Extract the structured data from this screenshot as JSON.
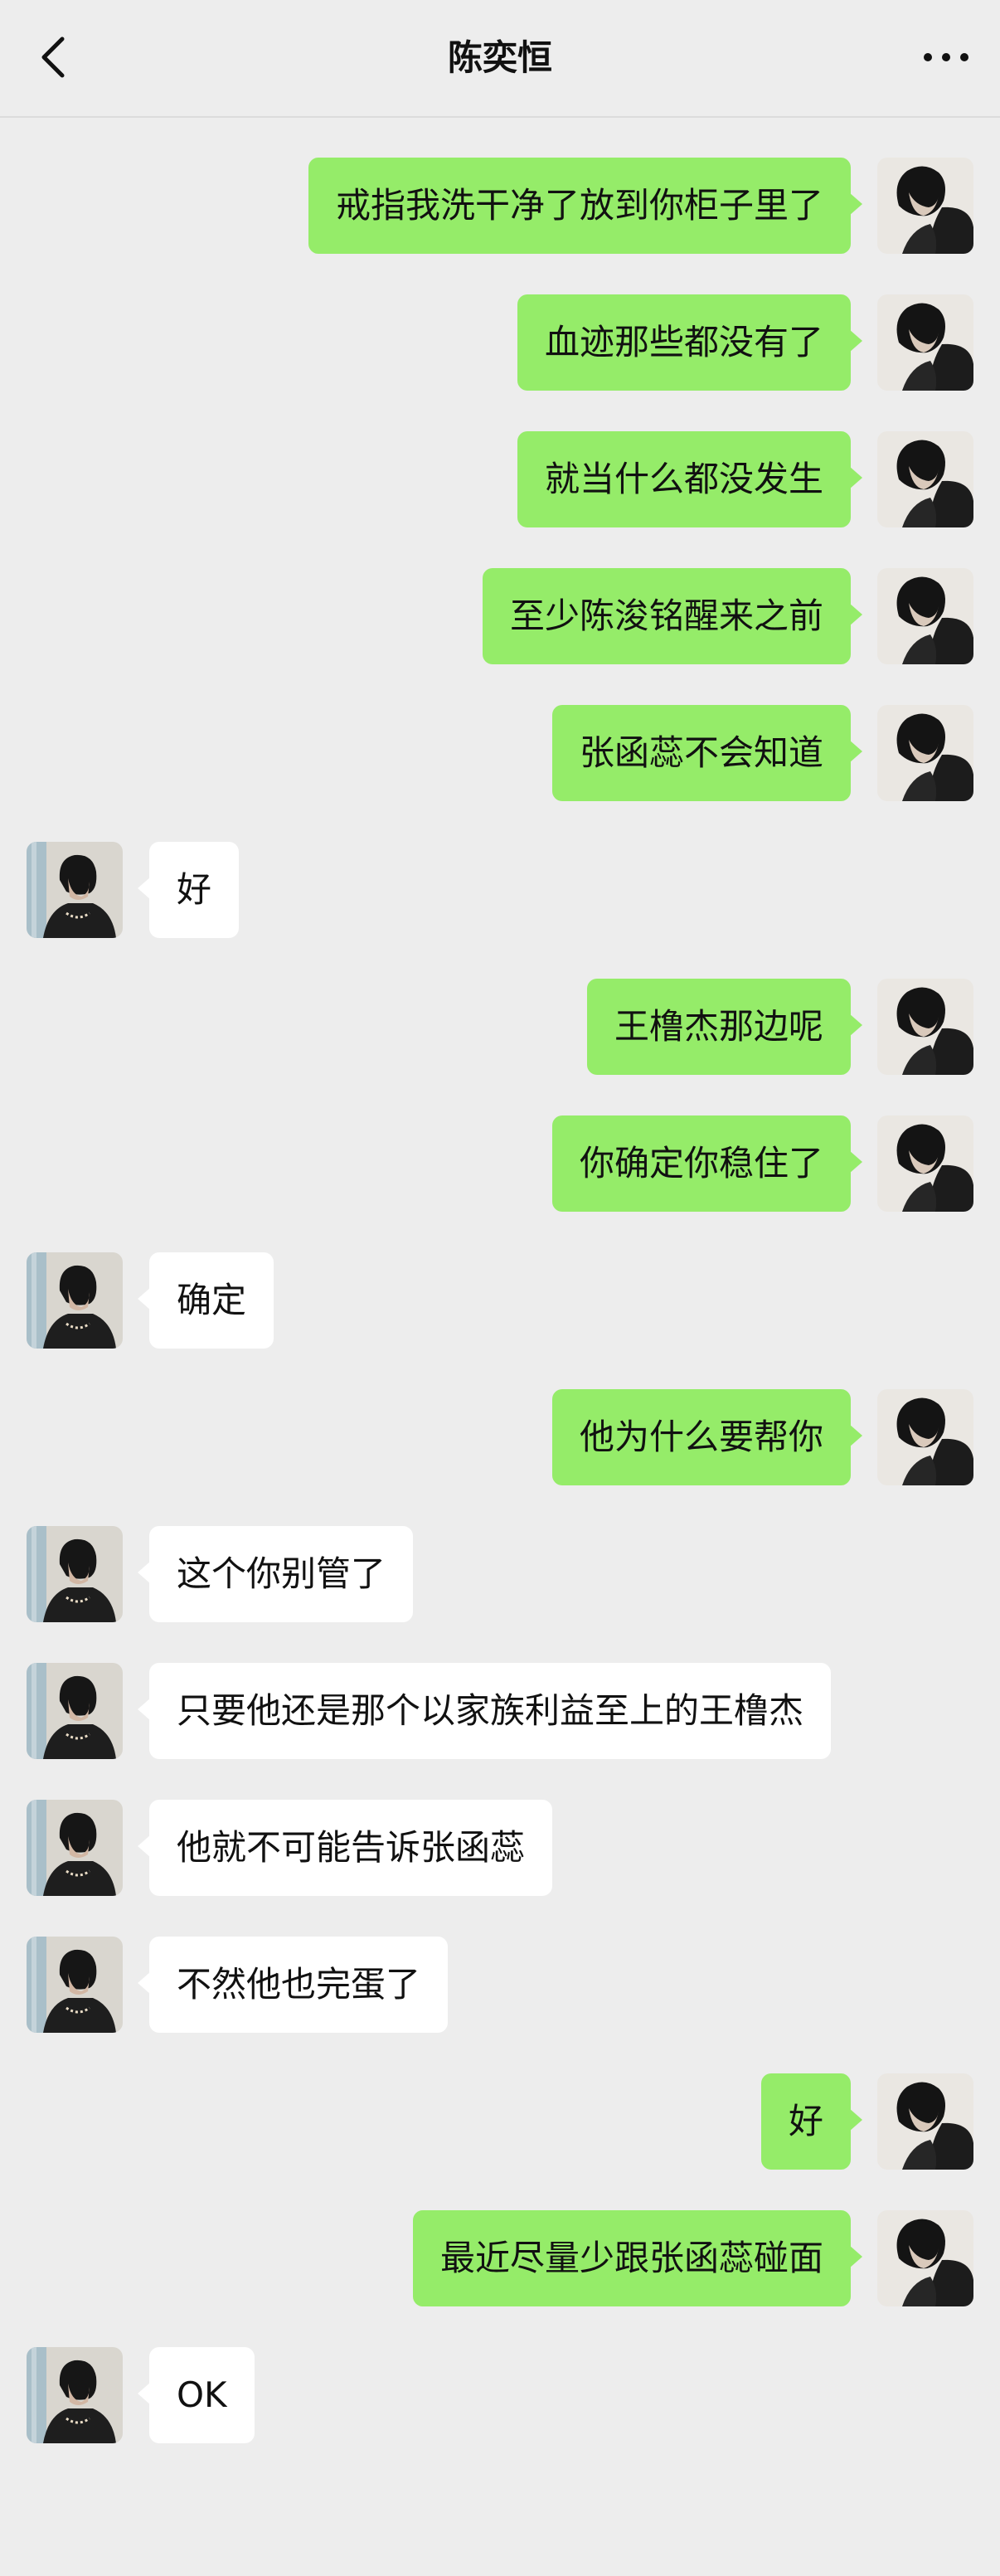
{
  "header": {
    "title": "陈奕恒",
    "back_icon": "chevron-left-icon",
    "more_icon": "ellipsis-icon"
  },
  "colors": {
    "background": "#ededed",
    "outgoing_bubble": "#95ec69",
    "incoming_bubble": "#ffffff"
  },
  "messages": [
    {
      "side": "out",
      "text": "戒指我洗干净了放到你柜子里了"
    },
    {
      "side": "out",
      "text": "血迹那些都没有了"
    },
    {
      "side": "out",
      "text": "就当什么都没发生"
    },
    {
      "side": "out",
      "text": "至少陈浚铭醒来之前"
    },
    {
      "side": "out",
      "text": "张函蕊不会知道"
    },
    {
      "side": "in",
      "text": "好"
    },
    {
      "side": "out",
      "text": "王橹杰那边呢"
    },
    {
      "side": "out",
      "text": "你确定你稳住了"
    },
    {
      "side": "in",
      "text": "确定"
    },
    {
      "side": "out",
      "text": "他为什么要帮你"
    },
    {
      "side": "in",
      "text": "这个你别管了"
    },
    {
      "side": "in",
      "text": "只要他还是那个以家族利益至上的王橹杰"
    },
    {
      "side": "in",
      "text": "他就不可能告诉张函蕊"
    },
    {
      "side": "in",
      "text": "不然他也完蛋了"
    },
    {
      "side": "out",
      "text": "好"
    },
    {
      "side": "out",
      "text": "最近尽量少跟张函蕊碰面"
    },
    {
      "side": "in",
      "text": "OK"
    }
  ]
}
